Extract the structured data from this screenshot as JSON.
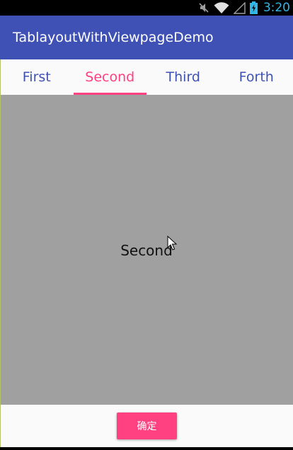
{
  "status_bar": {
    "time": "3:20",
    "icons": [
      "mute-icon",
      "wifi-icon",
      "signal-icon",
      "battery-charging-icon"
    ]
  },
  "app_bar": {
    "title": "TablayoutWithViewpageDemo",
    "color": "#3f51b5"
  },
  "tabs": [
    {
      "label": "First",
      "selected": false
    },
    {
      "label": "Second",
      "selected": true
    },
    {
      "label": "Third",
      "selected": false
    },
    {
      "label": "Forth",
      "selected": false
    }
  ],
  "page": {
    "text": "Second"
  },
  "bottom": {
    "confirm_label": "确定"
  },
  "colors": {
    "primary": "#3f51b5",
    "accent": "#ff4081",
    "page_background": "#a0a0a0",
    "status_time": "#33b5e5"
  }
}
